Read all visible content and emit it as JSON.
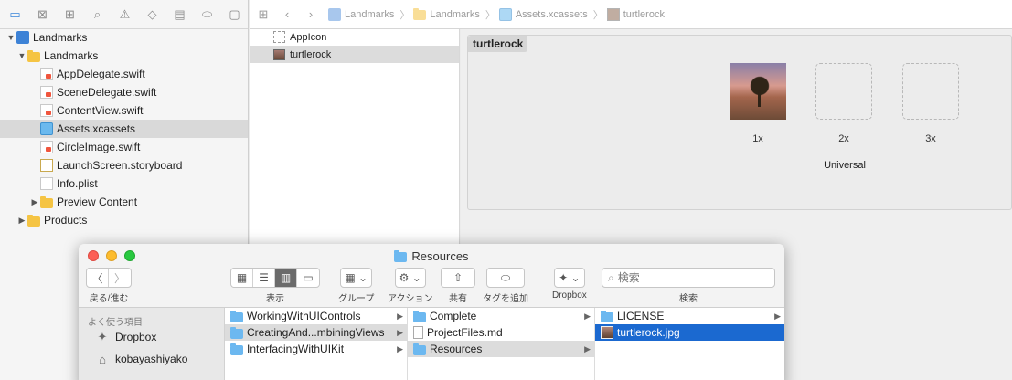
{
  "navigator": {
    "tree": [
      {
        "label": "Landmarks",
        "depth": 0,
        "disclosure": "open",
        "icon": "project-icon"
      },
      {
        "label": "Landmarks",
        "depth": 1,
        "disclosure": "open",
        "icon": "folder-icon"
      },
      {
        "label": "AppDelegate.swift",
        "depth": 2,
        "icon": "swift-file-icon"
      },
      {
        "label": "SceneDelegate.swift",
        "depth": 2,
        "icon": "swift-file-icon"
      },
      {
        "label": "ContentView.swift",
        "depth": 2,
        "icon": "swift-file-icon"
      },
      {
        "label": "Assets.xcassets",
        "depth": 2,
        "icon": "asset-catalog-icon",
        "selected": true
      },
      {
        "label": "CircleImage.swift",
        "depth": 2,
        "icon": "swift-file-icon"
      },
      {
        "label": "LaunchScreen.storyboard",
        "depth": 2,
        "icon": "storyboard-icon"
      },
      {
        "label": "Info.plist",
        "depth": 2,
        "icon": "plist-icon"
      },
      {
        "label": "Preview Content",
        "depth": 2,
        "disclosure": "closed",
        "icon": "folder-icon"
      },
      {
        "label": "Products",
        "depth": 1,
        "disclosure": "closed",
        "icon": "folder-icon"
      }
    ]
  },
  "editor": {
    "breadcrumbs": [
      "Landmarks",
      "Landmarks",
      "Assets.xcassets",
      "turtlerock"
    ],
    "asset_list": [
      {
        "label": "AppIcon"
      },
      {
        "label": "turtlerock",
        "selected": true
      }
    ],
    "set_name": "turtlerock",
    "slots": [
      "1x",
      "2x",
      "3x"
    ],
    "universal": "Universal"
  },
  "finder": {
    "title": "Resources",
    "toolbar": {
      "back_forward": "戻る/進む",
      "view": "表示",
      "group": "グループ",
      "action": "アクション",
      "share": "共有",
      "tags": "タグを追加",
      "dropbox": "Dropbox",
      "search": "検索",
      "search_placeholder": "検索"
    },
    "sidebar": {
      "heading": "よく使う項目",
      "items": [
        "Dropbox",
        "kobayashiyako"
      ]
    },
    "columns": [
      [
        "WorkingWithUIControls",
        "CreatingAnd...mbiningViews",
        "InterfacingWithUIKit"
      ],
      [
        "Complete",
        "ProjectFiles.md",
        "Resources"
      ],
      [
        "LICENSE",
        "turtlerock.jpg"
      ]
    ]
  }
}
